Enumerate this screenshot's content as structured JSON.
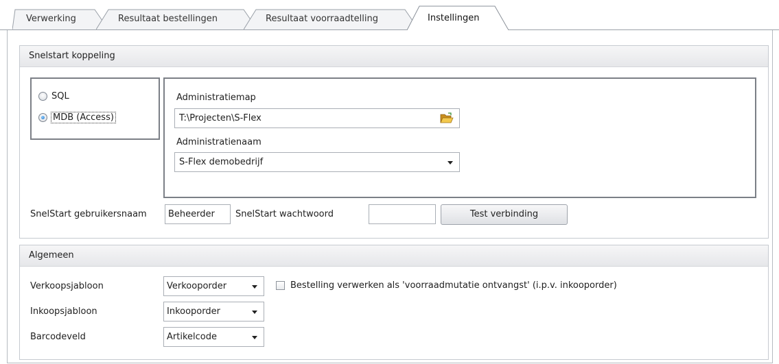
{
  "tabs": [
    {
      "label": "Verwerking",
      "active": false
    },
    {
      "label": "Resultaat bestellingen",
      "active": false
    },
    {
      "label": "Resultaat voorraadtelling",
      "active": false
    },
    {
      "label": "Instellingen",
      "active": true
    }
  ],
  "snelstart": {
    "header": "Snelstart koppeling",
    "radio_sql": "SQL",
    "radio_mdb": "MDB (Access)",
    "selected": "MDB (Access)",
    "admin_folder_label": "Administratiemap",
    "admin_folder_value": "T:\\Projecten\\S-Flex",
    "admin_name_label": "Administratienaam",
    "admin_name_value": "S-Flex demobedrijf",
    "username_label": "SnelStart gebruikersnaam",
    "username_value": "Beheerder",
    "password_label": "SnelStart wachtwoord",
    "password_value": "",
    "test_button": "Test verbinding"
  },
  "algemeen": {
    "header": "Algemeen",
    "verkoop_label": "Verkoopsjabloon",
    "verkoop_value": "Verkooporder",
    "inkoop_label": "Inkoopsjabloon",
    "inkoop_value": "Inkooporder",
    "barcode_label": "Barcodeveld",
    "barcode_value": "Artikelcode",
    "checkbox_label": "Bestelling verwerken als 'voorraadmutatie ontvangst' (i.p.v. inkooporder)",
    "checkbox_checked": false
  },
  "icons": {
    "folder": "open-folder-icon",
    "dropdown": "chevron-down-icon"
  },
  "colors": {
    "group_header_bg": "#e9eaed",
    "border": "#7b7f86",
    "radio_selected": "#1f6fc8",
    "folder": "#e8b341"
  }
}
